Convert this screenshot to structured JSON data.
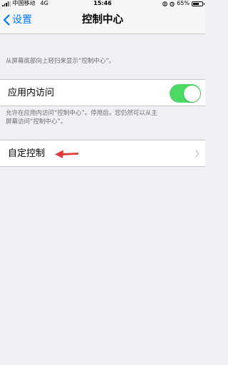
{
  "status_bar": {
    "carrier": "中国移动",
    "network": "4G",
    "time": "15:46",
    "battery": "65%",
    "battery_level": 0.65
  },
  "nav": {
    "back_label": "设置",
    "title": "控制中心"
  },
  "top_note": "从屏幕底部向上轻扫来显示“控制中心”。",
  "access_in_apps": {
    "label": "应用内访问",
    "toggle_on": true,
    "footer_line1": "允许在应用内访问“控制中心”。停用后，您仍然可以从主",
    "footer_line2": "屏幕访问“控制中心”。"
  },
  "customize": {
    "label": "自定控制"
  },
  "colors": {
    "accent": "#007aff",
    "toggle_on": "#4cd964",
    "annotation_arrow": "#e53935",
    "background": "#efeff4"
  },
  "icons": [
    "signal-icon",
    "location-icon",
    "alarm-icon",
    "battery-icon",
    "back-chevron-icon",
    "chevron-right-icon",
    "red-arrow-annotation"
  ]
}
